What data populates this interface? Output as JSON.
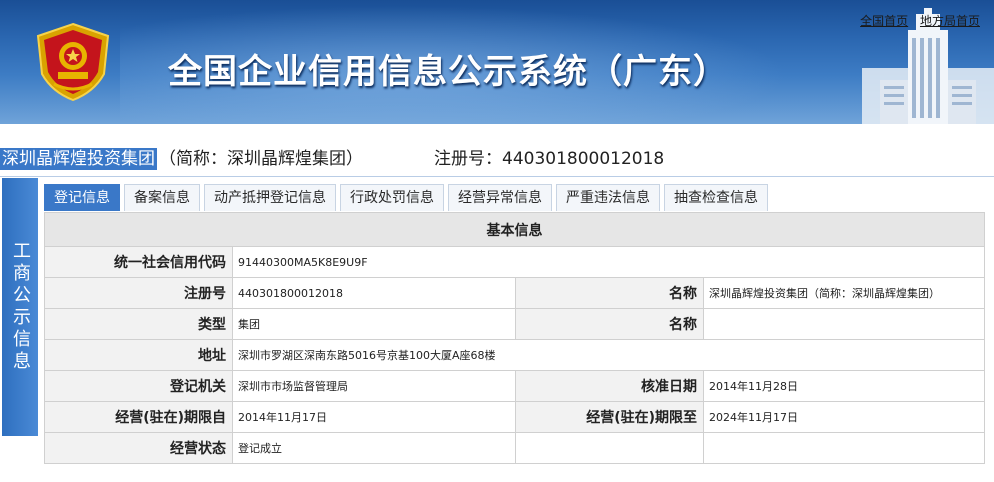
{
  "banner": {
    "title": "全国企业信用信息公示系统（广东）",
    "links": [
      "全国首页",
      "地方局首页"
    ]
  },
  "company": {
    "name": "深圳晶辉煌投资集团",
    "short": "（简称：深圳晶辉煌集团）",
    "reg_label": "注册号：440301800012018"
  },
  "side_tab": {
    "label": "工商公示信息"
  },
  "tabs": [
    {
      "label": "登记信息",
      "active": true
    },
    {
      "label": "备案信息"
    },
    {
      "label": "动产抵押登记信息"
    },
    {
      "label": "行政处罚信息"
    },
    {
      "label": "经营异常信息"
    },
    {
      "label": "严重违法信息"
    },
    {
      "label": "抽查检查信息"
    }
  ],
  "basic_info": {
    "header": "基本信息",
    "rows": [
      {
        "label": "统一社会信用代码",
        "value": "91440300MA5K8E9U9F"
      },
      {
        "label": "注册号",
        "value": "440301800012018",
        "label2": "名称",
        "value2": "深圳晶辉煌投资集团（简称：深圳晶辉煌集团）"
      },
      {
        "label": "类型",
        "value": "集团",
        "label2": "名称",
        "value2": ""
      },
      {
        "label": "地址",
        "value": "深圳市罗湖区深南东路5016号京基100大厦A座68楼"
      },
      {
        "label": "登记机关",
        "value": "深圳市市场监督管理局",
        "label2": "核准日期",
        "value2": "2014年11月28日"
      },
      {
        "label": "经营(驻在)期限自",
        "value": "2014年11月17日",
        "label2": "经营(驻在)期限至",
        "value2": "2024年11月17日"
      },
      {
        "label": "经营状态",
        "value": "登记成立",
        "label2": "",
        "value2": ""
      }
    ]
  }
}
